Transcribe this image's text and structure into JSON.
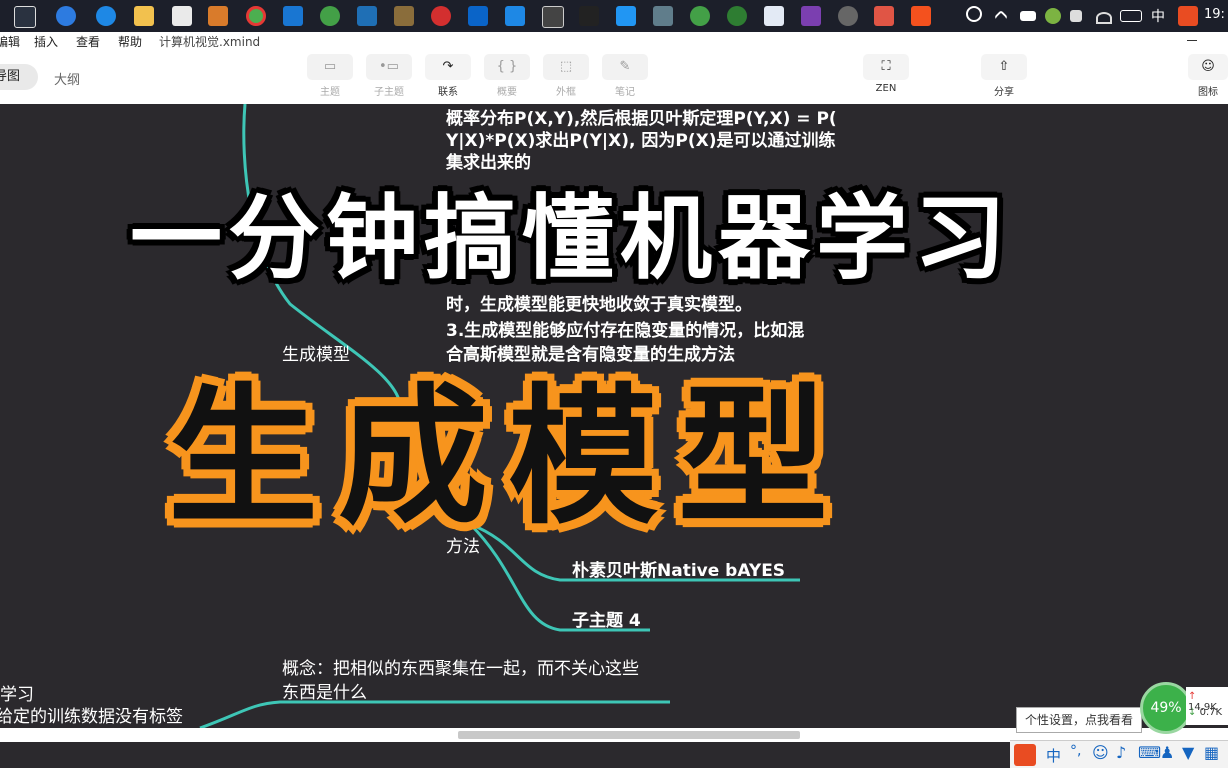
{
  "taskbar": {
    "icons": [
      "taskview-icon",
      "ie-icon",
      "edge-icon",
      "folder-icon",
      "store-icon",
      "app-icon",
      "chrome-icon",
      "app-icon",
      "wechat-icon",
      "jianguoyun-icon",
      "app-icon",
      "netease-icon",
      "outlook-icon",
      "vscode-icon",
      "code-icon",
      "app-icon",
      "app-icon",
      "app-icon",
      "app-icon",
      "app-icon",
      "app-icon",
      "vs-icon",
      "gear-icon",
      "xmind-icon",
      "app-icon"
    ],
    "tray_ime": "中",
    "clock": "19:"
  },
  "menubar": {
    "items": [
      "编辑",
      "插入",
      "查看",
      "帮助"
    ],
    "file_name": "计算机视觉.xmind"
  },
  "toolbar": {
    "tab_active": "导图",
    "tab_outline": "大纲",
    "tools": [
      {
        "label": "主题",
        "icon": "topic-icon"
      },
      {
        "label": "子主题",
        "icon": "subtopic-icon"
      },
      {
        "label": "联系",
        "icon": "relationship-icon",
        "active": true
      },
      {
        "label": "概要",
        "icon": "summary-icon"
      },
      {
        "label": "外框",
        "icon": "boundary-icon"
      },
      {
        "label": "笔记",
        "icon": "note-icon"
      }
    ],
    "zen": "ZEN",
    "share": "分享",
    "icon_label": "图标"
  },
  "mindmap": {
    "line1": "概率分布P(X,Y),然后根据贝叶斯定理P(Y,X) = P(",
    "line2": "Y|X)*P(X)求出P(Y|X), 因为P(X)是可以通过训练",
    "line3": "集求出来的",
    "line4": "时，生成模型能更快地收敛于真实模型。",
    "line5": "3.生成模型能够应付存在隐变量的情况，比如混",
    "line6": "合高斯模型就是含有隐变量的生成方法",
    "gen_node": "生成模型",
    "method": "方法",
    "naive": "朴素贝叶斯Native bAYES",
    "sub4": "子主题 4",
    "concept1": "概念：把相似的东西聚集在一起，而不关心这些",
    "concept2": "东西是什么",
    "left1": "学习",
    "left2": "给定的训练数据没有标签"
  },
  "overlay": {
    "title": "一分钟搞懂机器学习",
    "subtitle": "生成模型"
  },
  "status": {
    "tooltip": "个性设置，点我看看",
    "cpu": "49%",
    "net_up": "14.9K",
    "net_down": "0.7K",
    "ime": "中"
  },
  "colors": {
    "canvas": "#2b292d",
    "branch": "#3ec6b6",
    "accent_orange": "#f7941d"
  }
}
